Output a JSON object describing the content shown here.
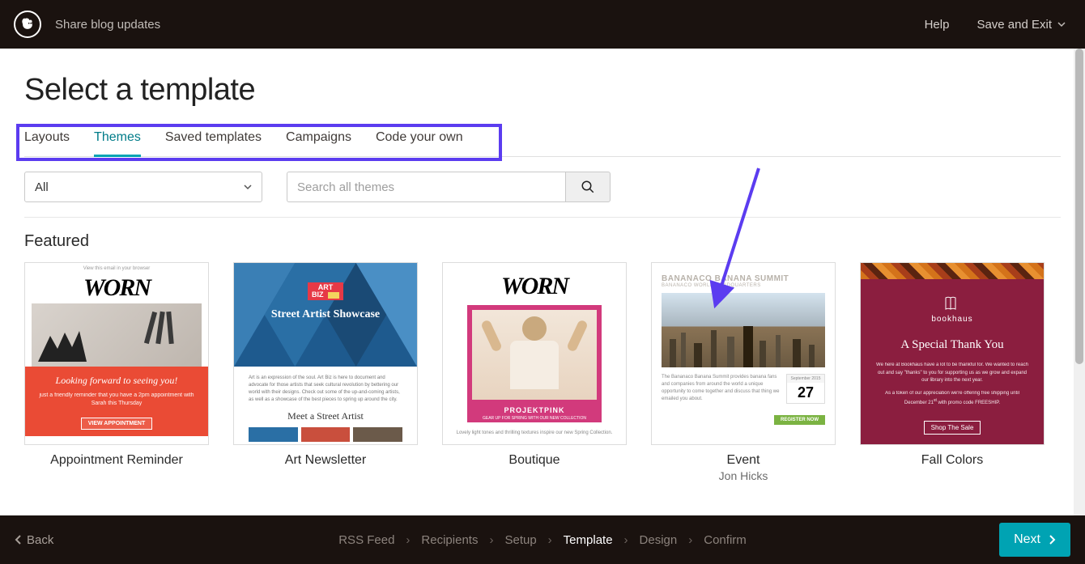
{
  "header": {
    "campaign_name": "Share blog updates",
    "help": "Help",
    "save_exit": "Save and Exit"
  },
  "page": {
    "title": "Select a template",
    "tabs": [
      "Layouts",
      "Themes",
      "Saved templates",
      "Campaigns",
      "Code your own"
    ],
    "active_tab_index": 1,
    "filter_dropdown": "All",
    "search_placeholder": "Search all themes",
    "section_title": "Featured"
  },
  "templates": [
    {
      "title": "Appointment Reminder",
      "sub": ""
    },
    {
      "title": "Art Newsletter",
      "sub": ""
    },
    {
      "title": "Boutique",
      "sub": ""
    },
    {
      "title": "Event",
      "sub": "Jon Hicks"
    },
    {
      "title": "Fall Colors",
      "sub": ""
    }
  ],
  "thumb0": {
    "brand": "WORN",
    "headline": "Looking forward to seeing you!",
    "body": "just a friendly reminder that you have a 2pm appointment with Sarah this Thursday",
    "cta": "VIEW APPOINTMENT",
    "tiny": "View this email in your browser"
  },
  "thumb1": {
    "badge1": "ART",
    "badge2": "BIZ",
    "headline": "Street Artist Showcase",
    "sub": "Meet a Street Artist"
  },
  "thumb2": {
    "brand": "WORN",
    "tag": "PROJEKTPINK",
    "cta_line": "GEAR UP FOR SPRING WITH OUR NEW COLLECTION"
  },
  "thumb3": {
    "title": "BANANACO BANANA SUMMIT",
    "sub": "BANANACO WORLD HEADQUARTERS",
    "month": "September 2015",
    "day": "27",
    "cta": "REGISTER NOW"
  },
  "thumb4": {
    "brand": "bookhaus",
    "headline": "A Special Thank You",
    "cta": "Shop The Sale"
  },
  "footer": {
    "back": "Back",
    "steps": [
      "RSS Feed",
      "Recipients",
      "Setup",
      "Template",
      "Design",
      "Confirm"
    ],
    "active_step_index": 3,
    "next": "Next"
  }
}
